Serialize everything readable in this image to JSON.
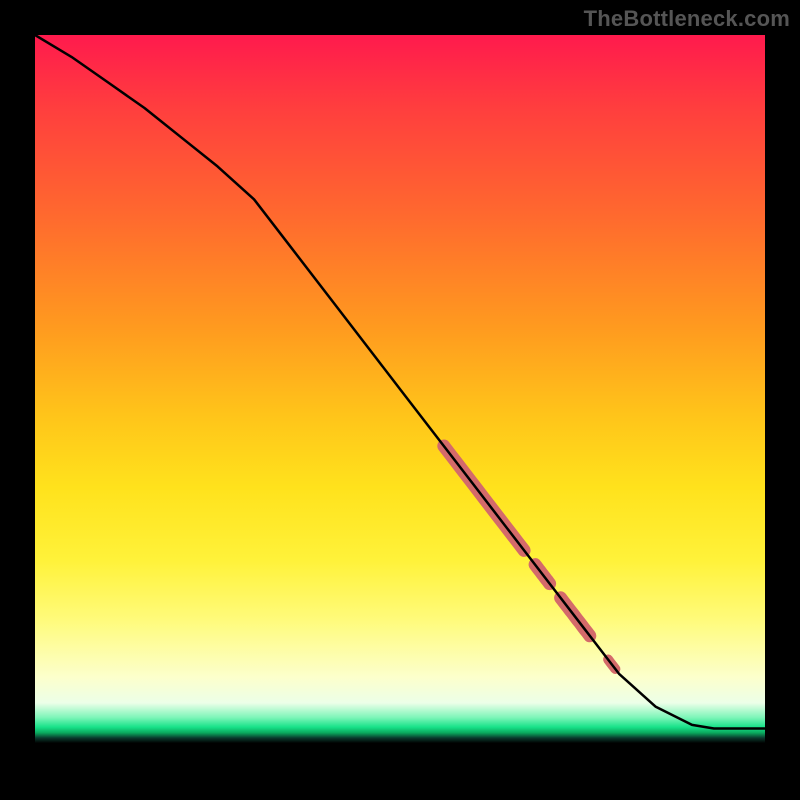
{
  "watermark": {
    "text": "TheBottleneck.com"
  },
  "colors": {
    "line": "#000000",
    "highlight": "#d46a6a",
    "background_black": "#000000"
  },
  "chart_data": {
    "type": "line",
    "title": "",
    "xlabel": "",
    "ylabel": "",
    "xlim": [
      0,
      100
    ],
    "ylim": [
      0,
      100
    ],
    "grid": false,
    "legend": false,
    "series": [
      {
        "name": "curve",
        "x": [
          0,
          5,
          10,
          15,
          20,
          25,
          30,
          35,
          40,
          45,
          50,
          55,
          60,
          65,
          70,
          75,
          80,
          85,
          90,
          93,
          95,
          100
        ],
        "y": [
          100,
          97,
          93.5,
          90,
          86,
          82,
          77.5,
          71,
          64.5,
          58,
          51.5,
          45,
          38.5,
          32,
          25.5,
          19,
          12.5,
          8,
          5.5,
          5,
          5,
          5
        ]
      }
    ],
    "highlight_segments": [
      {
        "x_start": 56,
        "x_end": 67,
        "thick": true
      },
      {
        "x_start": 68.5,
        "x_end": 70.5,
        "thick": true
      },
      {
        "x_start": 72,
        "x_end": 76,
        "thick": true
      },
      {
        "x_start": 78.5,
        "x_end": 79.5,
        "thick": false
      }
    ]
  }
}
